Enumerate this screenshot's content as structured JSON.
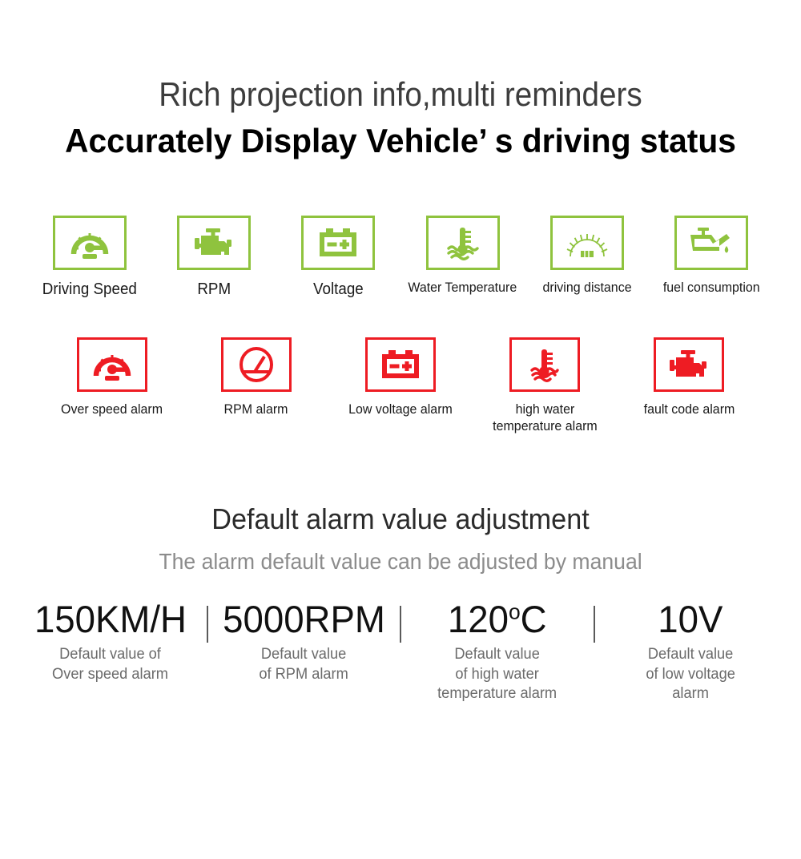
{
  "hero": {
    "subtitle": "Rich projection info,multi reminders",
    "title": "Accurately Display Vehicle’  s driving status"
  },
  "colors": {
    "green": "#8fc33e",
    "red": "#ee1c23",
    "heading_gray": "#3d3d3d",
    "desc_gray": "#8c8c8c",
    "value_desc_gray": "#6b6b6b"
  },
  "features": {
    "items": [
      {
        "icon": "speedometer-icon",
        "label": "Driving Speed",
        "size": "lg"
      },
      {
        "icon": "engine-icon",
        "label": "RPM",
        "size": "lg"
      },
      {
        "icon": "battery-icon",
        "label": "Voltage",
        "size": "lg"
      },
      {
        "icon": "water-temperature-icon",
        "label": "Water Temperature",
        "size": "sm"
      },
      {
        "icon": "odometer-icon",
        "label": "driving distance",
        "size": "sm"
      },
      {
        "icon": "oil-can-icon",
        "label": "fuel consumption",
        "size": "sm"
      }
    ]
  },
  "alarms": {
    "items": [
      {
        "icon": "speedometer-alarm-icon",
        "label": "Over speed alarm"
      },
      {
        "icon": "tachometer-alarm-icon",
        "label": "RPM alarm"
      },
      {
        "icon": "battery-alarm-icon",
        "label": "Low voltage alarm"
      },
      {
        "icon": "water-temperature-alarm-icon",
        "label": "high water\ntemperature alarm"
      },
      {
        "icon": "engine-alarm-icon",
        "label": "fault code alarm"
      }
    ]
  },
  "defaults": {
    "title": "Default alarm value adjustment",
    "description": "The alarm default value can be adjusted by manual",
    "items": [
      {
        "value": "150KM/H",
        "unit_sup": "",
        "value_tail": "",
        "description": "Default value of\nOver speed alarm"
      },
      {
        "value": "5000RPM",
        "unit_sup": "",
        "value_tail": "",
        "description": "Default value\nof RPM alarm"
      },
      {
        "value": "120",
        "unit_sup": "o",
        "value_tail": "C",
        "description": "Default value\nof high water\ntemperature alarm"
      },
      {
        "value": "10V",
        "unit_sup": "",
        "value_tail": "",
        "description": "Default value\nof low voltage\nalarm"
      }
    ]
  }
}
